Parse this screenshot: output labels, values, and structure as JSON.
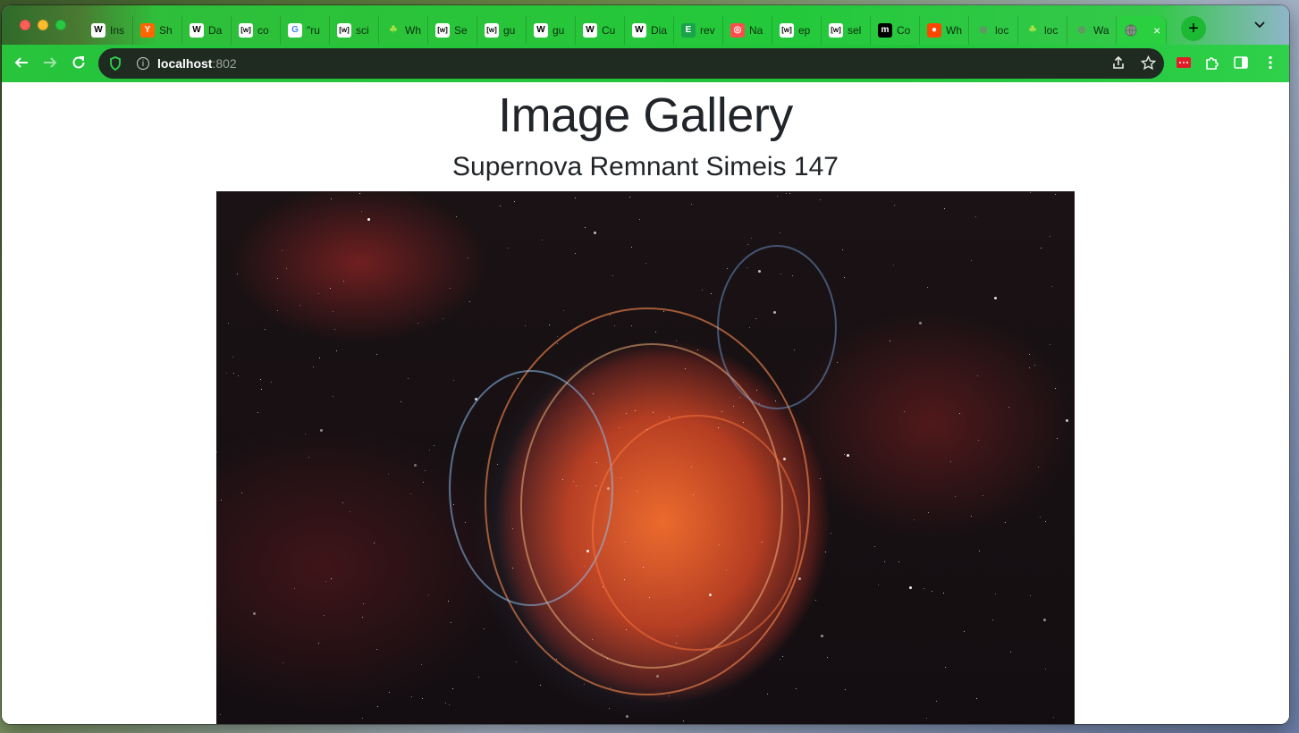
{
  "browser": {
    "tabs": [
      {
        "favicon": "wikipedia-icon",
        "label": "Ins"
      },
      {
        "favicon": "ycombinator-icon",
        "label": "Sh"
      },
      {
        "favicon": "wikipedia-icon",
        "label": "Da"
      },
      {
        "favicon": "wiktionary-icon",
        "label": "co"
      },
      {
        "favicon": "google-icon",
        "label": "\"ru"
      },
      {
        "favicon": "wiktionary-icon",
        "label": "sci"
      },
      {
        "favicon": "leaf-icon",
        "label": "Wh"
      },
      {
        "favicon": "wiktionary-icon",
        "label": "Se"
      },
      {
        "favicon": "wiktionary-icon",
        "label": "gu"
      },
      {
        "favicon": "wikipedia-icon",
        "label": "gu"
      },
      {
        "favicon": "wikipedia-icon",
        "label": "Cu"
      },
      {
        "favicon": "wikipedia-icon",
        "label": "Dia"
      },
      {
        "favicon": "e-icon",
        "label": "rev"
      },
      {
        "favicon": "na-icon",
        "label": "Na"
      },
      {
        "favicon": "wiktionary-icon",
        "label": "ep"
      },
      {
        "favicon": "wiktionary-icon",
        "label": "sel"
      },
      {
        "favicon": "m-icon",
        "label": "Co"
      },
      {
        "favicon": "reddit-icon",
        "label": "Wh"
      },
      {
        "favicon": "globe-icon",
        "label": "loc"
      },
      {
        "favicon": "leaf-icon",
        "label": "loc"
      },
      {
        "favicon": "globe-icon",
        "label": "Wa"
      }
    ],
    "active_tab": {
      "favicon": "globe-icon",
      "close": "×"
    },
    "new_tab": "+",
    "url_host": "localhost",
    "url_port": ":802"
  },
  "page": {
    "title": "Image Gallery",
    "image_caption": "Supernova Remnant Simeis 147"
  },
  "colors": {
    "tab_bar": "#23c93a",
    "toolbar": "#27c43c",
    "address_bar": "#1f2a21",
    "heading_text": "#212529"
  }
}
